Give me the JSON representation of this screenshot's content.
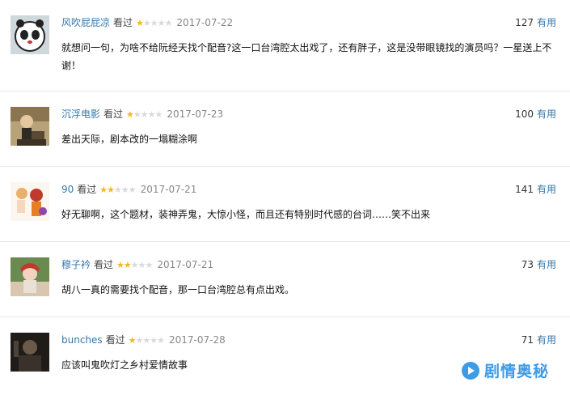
{
  "reviews": [
    {
      "author": "风吹屁屁凉",
      "status": "看过",
      "rating": 1,
      "date": "2017-07-22",
      "votes": "127",
      "votes_label": "有用",
      "content": "就想问一句，为啥不给阮经天找个配音?这一口台湾腔太出戏了，还有胖子，这是没带眼镜找的演员吗？一星送上不谢！"
    },
    {
      "author": "沉浮电影",
      "status": "看过",
      "rating": 1,
      "date": "2017-07-23",
      "votes": "100",
      "votes_label": "有用",
      "content": "差出天际，剧本改的一塌糊涂啊"
    },
    {
      "author": "90",
      "status": "看过",
      "rating": 2,
      "date": "2017-07-21",
      "votes": "141",
      "votes_label": "有用",
      "content": "好无聊啊，这个题材，装神弄鬼，大惊小怪，而且还有特别时代感的台词……笑不出来"
    },
    {
      "author": "穆子衿",
      "status": "看过",
      "rating": 2,
      "date": "2017-07-21",
      "votes": "73",
      "votes_label": "有用",
      "content": "胡八一真的需要找个配音，那一口台湾腔总有点出戏。"
    },
    {
      "author": "bunches",
      "status": "看过",
      "rating": 1,
      "date": "2017-07-28",
      "votes": "71",
      "votes_label": "有用",
      "content": "应该叫鬼吹灯之乡村爱情故事"
    }
  ],
  "watermark": {
    "text": "剧情奥秘",
    "color": "#3d9be8"
  },
  "colors": {
    "link": "#3377aa",
    "star_on": "#f7b71c",
    "star_off": "#d9d9d9"
  }
}
